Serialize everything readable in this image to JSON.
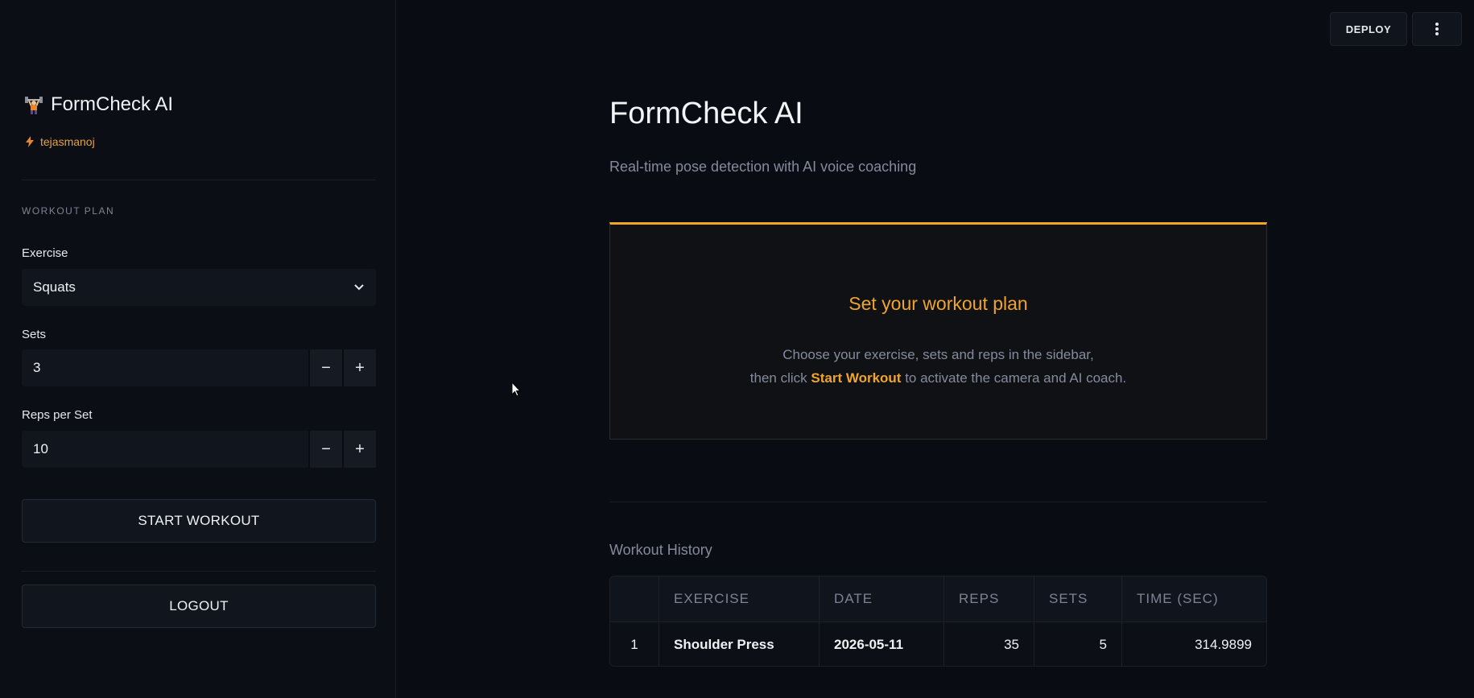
{
  "header": {
    "deploy_label": "DEPLOY",
    "menu_icon": "vertical-dots-icon"
  },
  "sidebar": {
    "app_title": "FormCheck AI",
    "app_icon": "weightlifter-icon",
    "username": "tejasmanoj",
    "user_icon": "lightning-icon",
    "section_label": "WORKOUT PLAN",
    "exercise_label": "Exercise",
    "exercise_value": "Squats",
    "sets_label": "Sets",
    "sets_value": "3",
    "reps_label": "Reps per Set",
    "reps_value": "10",
    "minus": "−",
    "plus": "+",
    "start_label": "START WORKOUT",
    "logout_label": "LOGOUT"
  },
  "main": {
    "title": "FormCheck AI",
    "subtitle": "Real-time pose detection with AI voice coaching",
    "card": {
      "title": "Set your workout plan",
      "line1": "Choose your exercise, sets and reps in the sidebar,",
      "line2_pre": "then click ",
      "line2_highlight": "Start Workout",
      "line2_post": " to activate the camera and AI coach."
    },
    "history_label": "Workout History",
    "table": {
      "headers": [
        "",
        "EXERCISE",
        "DATE",
        "REPS",
        "SETS",
        "TIME (SEC)"
      ],
      "rows": [
        [
          "1",
          "Shoulder Press",
          "2026-05-11",
          "35",
          "5",
          "314.9899"
        ]
      ]
    }
  },
  "colors": {
    "accent": "#f0a52a",
    "background": "#090c12",
    "sidebar": "#0b0e15"
  }
}
